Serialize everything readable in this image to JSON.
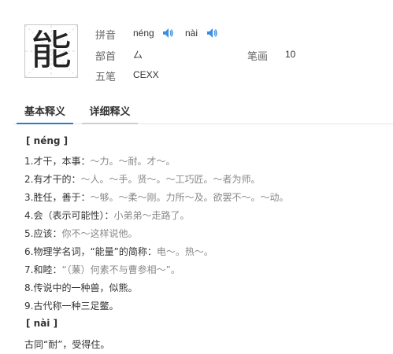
{
  "character": "能",
  "pinyin": {
    "label": "拼音",
    "readings": [
      "néng",
      "nài"
    ]
  },
  "radical": {
    "label": "部首",
    "value": "厶"
  },
  "strokes": {
    "label": "笔画",
    "value": "10"
  },
  "wubi": {
    "label": "五笔",
    "value": "CEXX"
  },
  "tabs": [
    {
      "label": "基本释义",
      "active": true
    },
    {
      "label": "详细释义",
      "active": false
    }
  ],
  "sections": [
    {
      "heading": "[ néng ]",
      "definitions": [
        {
          "text": "1.才干，本事：",
          "example": "～力。～耐。才～。"
        },
        {
          "text": "2.有才干的：",
          "example": "～人。～手。贤～。～工巧匠。～者为师。"
        },
        {
          "text": "3.胜任，善于：",
          "example": "～够。～柔～刚。力所～及。欲罢不～。～动。"
        },
        {
          "text": "4.会（表示可能性）：",
          "example": "小弟弟～走路了。"
        },
        {
          "text": "5.应该：",
          "example": "你不～这样说他。"
        },
        {
          "text": "6.物理学名词，“能量”的简称：",
          "example": "电～。热～。"
        },
        {
          "text": "7.和睦：",
          "example": "“（蒹）何素不与曹参相～”。"
        },
        {
          "text": "8.传说中的一种兽，似熊。",
          "example": ""
        },
        {
          "text": "9.古代称一种三足鳖。",
          "example": ""
        }
      ]
    },
    {
      "heading": "[ nài ]",
      "definitions": [
        {
          "text": "古同“耐”，受得住。",
          "example": ""
        }
      ]
    }
  ],
  "colors": {
    "tab_active_underline": "#2b7bd6",
    "speaker_icon": "#3b8fe0",
    "example_text": "#888888"
  }
}
